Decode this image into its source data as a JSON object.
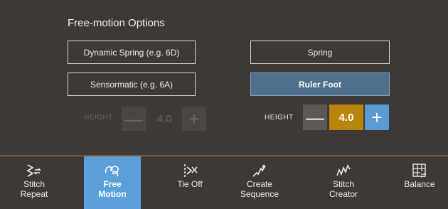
{
  "panel": {
    "title": "Free-motion Options",
    "options": [
      {
        "label": "Dynamic Spring (e.g. 6D)",
        "selected": false
      },
      {
        "label": "Spring",
        "selected": false
      },
      {
        "label": "Sensormatic (e.g. 6A)",
        "selected": false
      },
      {
        "label": "Ruler Foot",
        "selected": true
      }
    ],
    "height_left": {
      "label": "HEIGHT",
      "minus": "—",
      "value": "4.0",
      "plus": "+",
      "enabled": false
    },
    "height_right": {
      "label": "HEIGHT",
      "minus": "—",
      "value": "4.0",
      "plus": "+",
      "enabled": true
    }
  },
  "toolbar": {
    "items": [
      {
        "label_line1": "Stitch",
        "label_line2": "Repeat",
        "icon": "stitch-repeat-icon",
        "active": false
      },
      {
        "label_line1": "Free",
        "label_line2": "Motion",
        "icon": "free-motion-icon",
        "active": true
      },
      {
        "label_line1": "Tie Off",
        "label_line2": "",
        "icon": "tie-off-icon",
        "active": false
      },
      {
        "label_line1": "Create",
        "label_line2": "Sequence",
        "icon": "create-sequence-icon",
        "active": false
      },
      {
        "label_line1": "Stitch",
        "label_line2": "Creator",
        "icon": "stitch-creator-icon",
        "active": false
      },
      {
        "label_line1": "Balance",
        "label_line2": "",
        "icon": "balance-icon",
        "active": false
      }
    ]
  },
  "colors": {
    "background": "#3d3936",
    "selected_option": "#4f6f8d",
    "value_highlight": "#b8860b",
    "plus_button": "#5b9bd3",
    "active_tool": "#5b9fdb"
  }
}
